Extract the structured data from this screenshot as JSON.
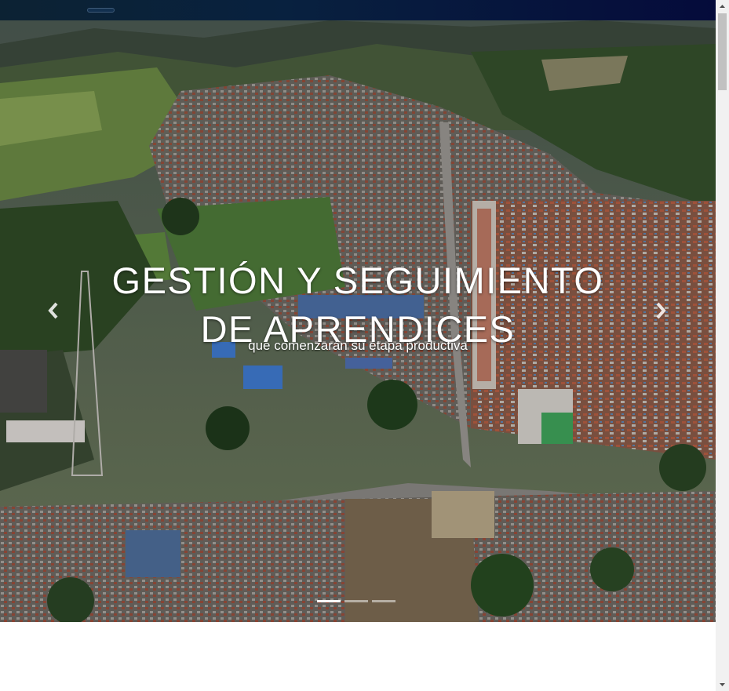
{
  "navbar": {
    "toggle_icon": "hamburger-toggle",
    "accent": "#050b3b"
  },
  "carousel": {
    "title": "GESTIÓN Y SEGUIMIENTO DE APRENDICES",
    "subtitle": "que comenzarán su etapa productiva",
    "prev_icon": "chevron-left-icon",
    "next_icon": "chevron-right-icon",
    "slide_count": 3,
    "active_slide": 1
  },
  "scrollbar": {
    "up_icon": "arrow-up-icon",
    "down_icon": "arrow-down-icon"
  }
}
